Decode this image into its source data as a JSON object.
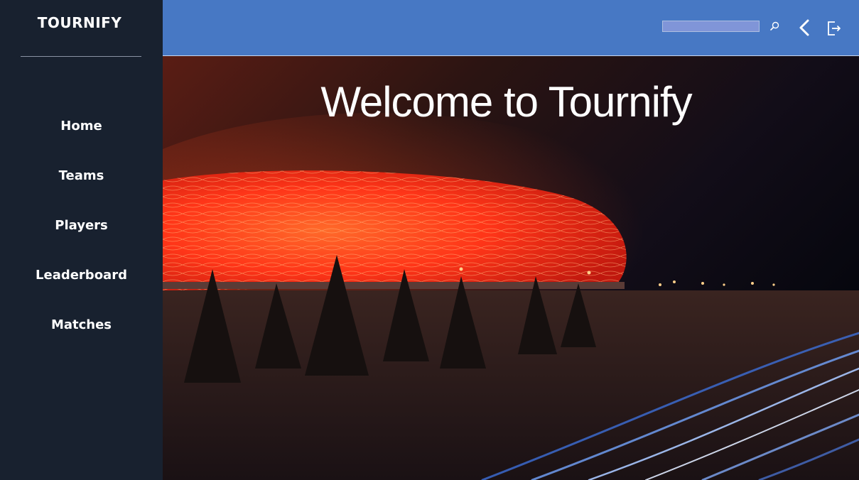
{
  "sidebar": {
    "brand": "TOURNIFY",
    "items": [
      {
        "label": "Home"
      },
      {
        "label": "Teams"
      },
      {
        "label": "Players"
      },
      {
        "label": "Leaderboard"
      },
      {
        "label": "Matches"
      }
    ]
  },
  "header": {
    "search": {
      "value": "",
      "placeholder": ""
    },
    "icons": [
      "search-icon",
      "back-chevron-icon",
      "logout-icon"
    ]
  },
  "hero": {
    "title": "Welcome to Tournify",
    "image": "stadium-at-night-photo"
  },
  "colors": {
    "sidebar_bg": "#18212f",
    "topbar_bg": "#4778c4",
    "stadium_glow": "#ff3b1a",
    "text": "#ffffff"
  }
}
